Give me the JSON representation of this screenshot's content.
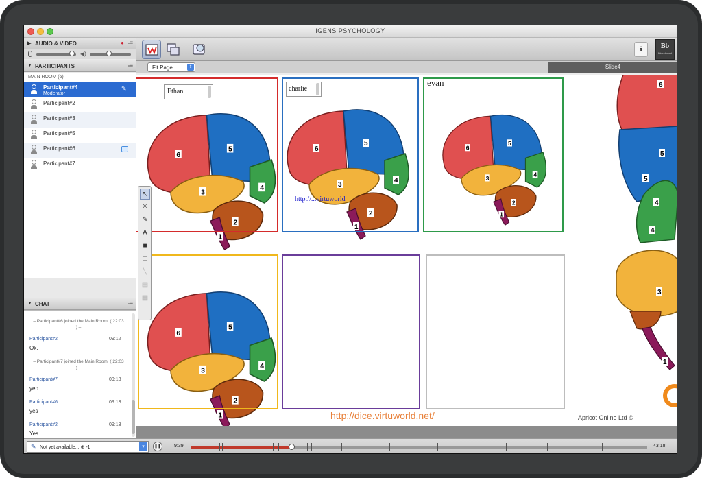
{
  "window": {
    "title": "IGENS PSYCHOLOGY"
  },
  "sidebar": {
    "audio_video": {
      "title": "AUDIO & VIDEO"
    },
    "participants": {
      "title": "PARTICIPANTS",
      "room_label": "MAIN ROOM",
      "room_count": "(6)",
      "items": [
        {
          "name": "Participant#4",
          "role": "Moderator"
        },
        {
          "name": "Participant#2"
        },
        {
          "name": "Participant#3"
        },
        {
          "name": "Participant#5"
        },
        {
          "name": "Participant#6"
        },
        {
          "name": "Participant#7"
        }
      ]
    },
    "chat": {
      "title": "CHAT",
      "messages": [
        {
          "system": "– Participant#6 joined the Main Room. ( 22:03 ) –"
        },
        {
          "user": "Participant#2",
          "time": "09:12",
          "text": "Ok."
        },
        {
          "system": "– Participant#7 joined the Main Room. ( 22:03 ) –"
        },
        {
          "user": "Participant#7",
          "time": "09:13",
          "text": "yep"
        },
        {
          "user": "Participant#6",
          "time": "09:13",
          "text": "yes"
        },
        {
          "user": "Participant#2",
          "time": "09:13",
          "text": "Yes"
        }
      ]
    }
  },
  "toolbar": {
    "info_label": "i",
    "bb_label": "Bb",
    "bb_sub": "Blackboard"
  },
  "view": {
    "zoom": "Fit Page",
    "slide": "Slide4"
  },
  "board": {
    "cards": [
      {
        "label": "Ethan",
        "color": "#d42b2b"
      },
      {
        "label": "charlie",
        "color": "#2a6fc0"
      },
      {
        "label": "evan",
        "color": "#2e9a4a"
      },
      {
        "label": "",
        "color": "#f0b81c"
      },
      {
        "label": "",
        "color": "#6a3d9a"
      },
      {
        "label": "",
        "color": "#bdbdbd"
      }
    ],
    "link_in_card": "http://...virtuworld",
    "footer_link": "http://dice.virtuworld.net/",
    "brand": "Apricot Online Ltd ©"
  },
  "status": {
    "select_label": "Not yet available... ⊕ -1",
    "time_start": "9:39",
    "time_end": "43:18",
    "progress": 0.22
  },
  "colors": {
    "red": "#e05050",
    "blue": "#1f6fc2",
    "green": "#3aa04a",
    "orange": "#f2b33c",
    "brown": "#b8551c",
    "purple": "#8b1a5a"
  }
}
